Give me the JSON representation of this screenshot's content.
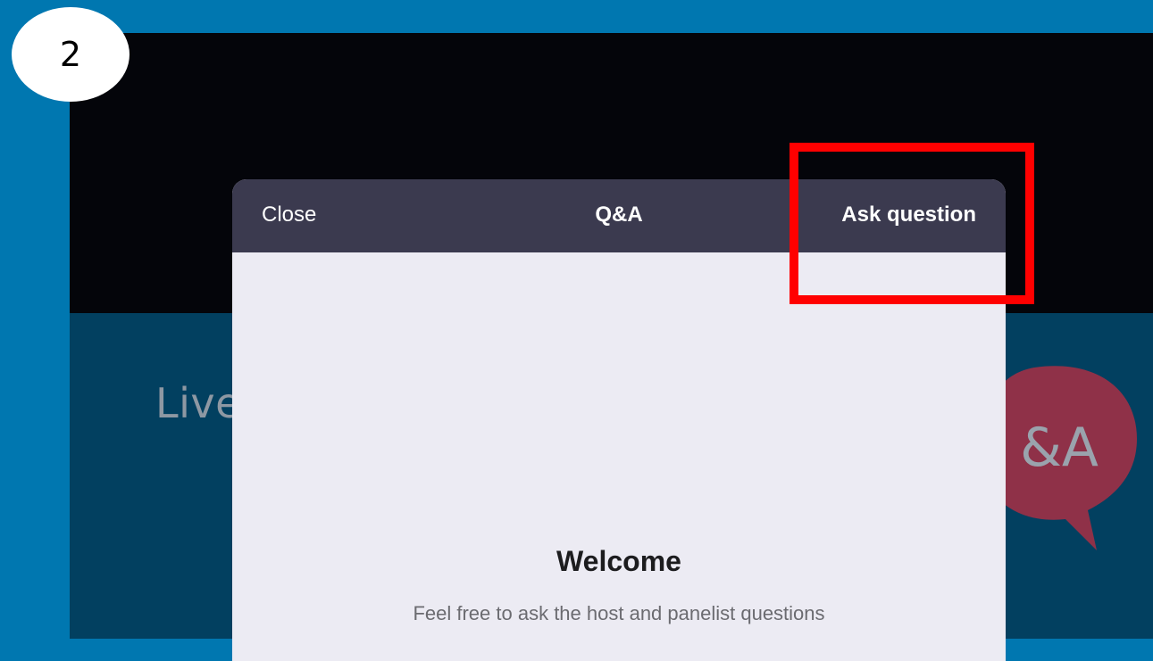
{
  "step": {
    "number": "2"
  },
  "background": {
    "live_text": "Live",
    "qa_graphic_text": "&A",
    "colors": {
      "outer": "#0077b0",
      "video": "#04050a",
      "banner": "#024060",
      "bubble": "#8f3148"
    }
  },
  "modal": {
    "header": {
      "close_label": "Close",
      "title": "Q&A",
      "ask_label": "Ask question"
    },
    "body": {
      "welcome_title": "Welcome",
      "welcome_subtitle": "Feel free to ask the host and panelist questions"
    },
    "colors": {
      "header_bg": "#3b3a4f",
      "body_bg": "#ecebf3"
    }
  },
  "annotation": {
    "highlight_color": "#ff0000",
    "highlight_target": "Ask question"
  }
}
